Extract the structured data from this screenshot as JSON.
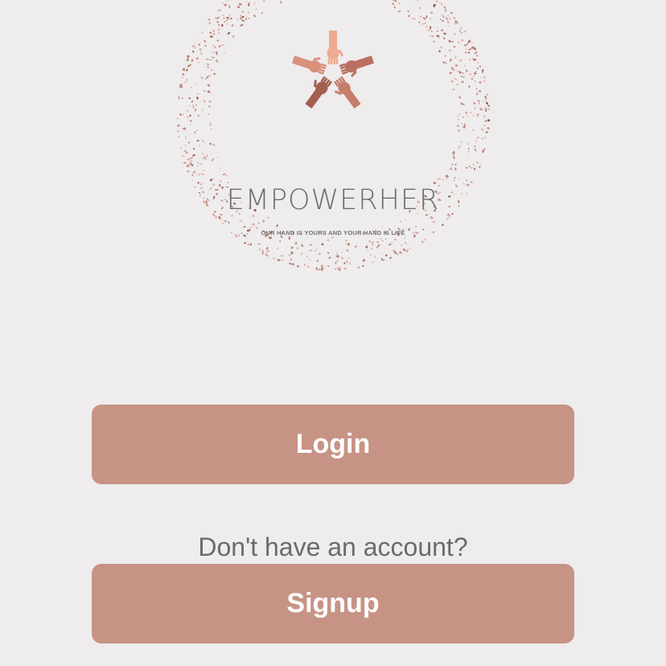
{
  "logo": {
    "brand_name": "EMPOWERHER",
    "tagline": "OUR HAND IS YOURS AND YOUR HAND IS LIFE",
    "icon": "five-hands-circle-icon",
    "accent_color": "#b26f5e"
  },
  "auth": {
    "login_label": "Login",
    "signup_prompt": "Don't have an account?",
    "signup_label": "Signup",
    "button_color": "#c79385"
  }
}
